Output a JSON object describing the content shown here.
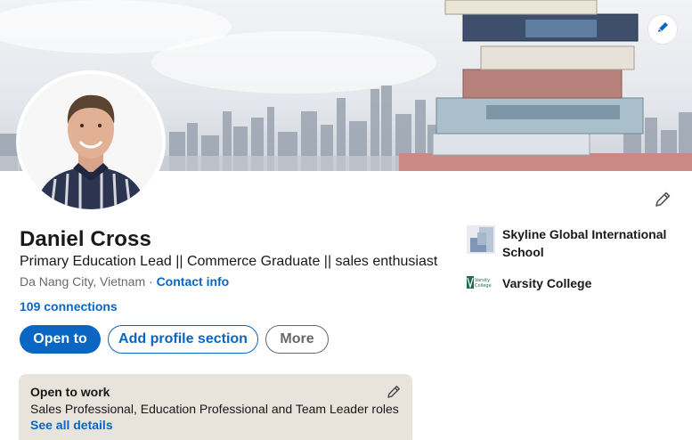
{
  "profile": {
    "name": "Daniel Cross",
    "headline": "Primary Education Lead || Commerce Graduate || sales enthusiast",
    "location": "Da Nang City, Vietnam",
    "separator": "·",
    "contact_label": "Contact info",
    "connections": "109 connections"
  },
  "actions": {
    "open_to": "Open to",
    "add_section": "Add profile section",
    "more": "More"
  },
  "open_to_work": {
    "title": "Open to work",
    "description": "Sales Professional, Education Professional and Team Leader roles",
    "link": "See all details"
  },
  "experience": [
    {
      "name": "Skyline Global International School",
      "logo": "skyline-logo-icon"
    },
    {
      "name": "Varsity College",
      "logo": "varsity-college-logo-icon",
      "logo_text": "Varsity College"
    }
  ],
  "colors": {
    "accent": "#0a66c2",
    "card_bg": "#e8e4dc"
  },
  "icons": {
    "banner_edit": "pencil-icon",
    "profile_edit": "pencil-icon",
    "otw_edit": "pencil-icon"
  }
}
